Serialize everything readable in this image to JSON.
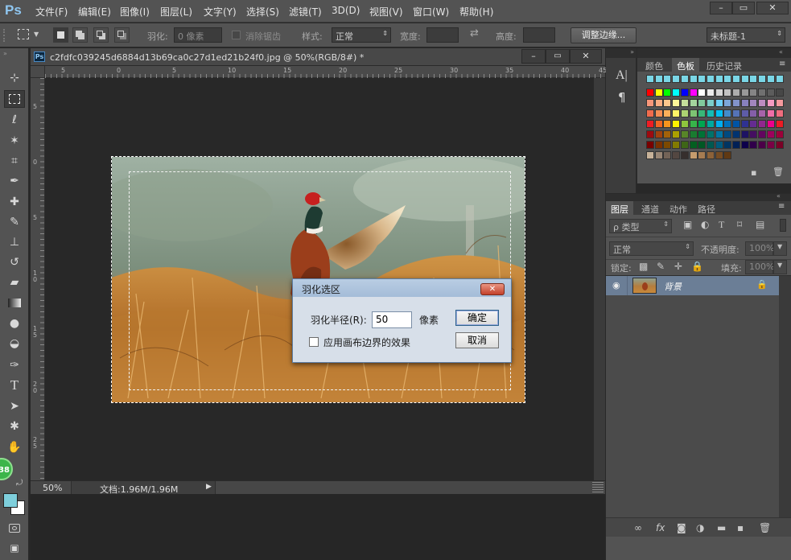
{
  "app": {
    "logo": "Ps"
  },
  "menu": [
    "文件(F)",
    "编辑(E)",
    "图像(I)",
    "图层(L)",
    "文字(Y)",
    "选择(S)",
    "滤镜(T)",
    "3D(D)",
    "视图(V)",
    "窗口(W)",
    "帮助(H)"
  ],
  "window_controls": {
    "minimize": "–",
    "restore": "▭",
    "close": "✕"
  },
  "options_bar": {
    "feather_label": "羽化:",
    "feather_value": "0 像素",
    "antialias_label": "消除锯齿",
    "style_label": "样式:",
    "style_value": "正常",
    "width_label": "宽度:",
    "height_label": "高度:",
    "refine_button": "调整边缘...",
    "workspace": "未标题-1"
  },
  "document": {
    "badge": "Ps",
    "title": "c2fdfc039245d6884d13b69ca0c27d1ed21b24f0.jpg @ 50%(RGB/8#) *",
    "zoom": "50%",
    "doc_size": "文档:1.96M/1.96M"
  },
  "ruler": {
    "h_labels": [
      "5",
      "0",
      "5",
      "10",
      "15",
      "20",
      "25",
      "30",
      "35",
      "40",
      "45"
    ],
    "v_labels": [
      "5",
      "0",
      "5",
      "1\n0",
      "1\n5",
      "2\n0",
      "2\n5"
    ]
  },
  "dialog": {
    "title": "羽化选区",
    "radius_label": "羽化半径(R):",
    "radius_value": "50",
    "unit": "像素",
    "ok": "确定",
    "cancel": "取消",
    "checkbox_label": "应用画布边界的效果"
  },
  "swatch_panel": {
    "tabs": [
      "颜色",
      "色板",
      "历史记录"
    ],
    "active_tab": "色板"
  },
  "layers_panel": {
    "tabs": [
      "图层",
      "通道",
      "动作",
      "路径"
    ],
    "active_tab": "图层",
    "filter_kind": "ρ 类型",
    "blend_mode": "正常",
    "opacity_label": "不透明度:",
    "opacity_value": "100%",
    "lock_label": "锁定:",
    "fill_label": "填充:",
    "fill_value": "100%",
    "layer_name": "背景"
  },
  "badge_number": "38",
  "colors": {
    "foreground": "#7ecfdc",
    "background": "#ffffff",
    "dialog_title_bg": "#a4bcd8",
    "selected_layer": "#6b7e96"
  }
}
